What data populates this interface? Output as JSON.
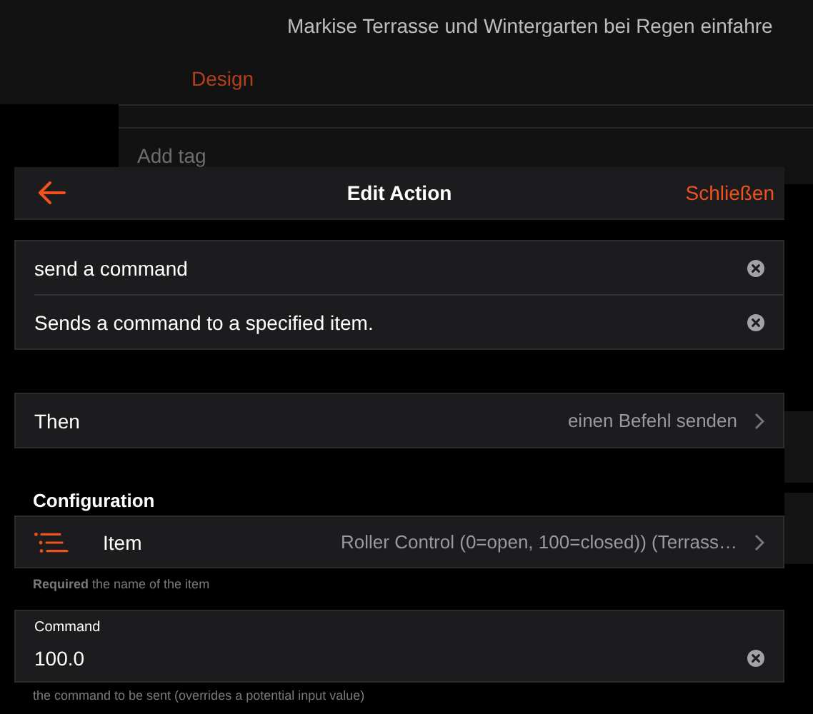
{
  "background": {
    "title": "Markise Terrasse und Wintergarten bei Regen einfahre",
    "tab": "Design",
    "tags_placeholder": "Add tag"
  },
  "sheet": {
    "title": "Edit Action",
    "close": "Schließen"
  },
  "fields": [
    {
      "value": "send a command"
    },
    {
      "value": "Sends a command to a specified item."
    }
  ],
  "then_row": {
    "label": "Then",
    "value": "einen Befehl senden"
  },
  "section": "Configuration",
  "item_row": {
    "label": "Item",
    "value": "Roller Control (0=open, 100=closed)) (Terrass…",
    "hint": "**Required** the name of the item"
  },
  "command": {
    "label": "Command",
    "value": "100.0",
    "hint": "the command to be sent (overrides a potential input value)"
  }
}
